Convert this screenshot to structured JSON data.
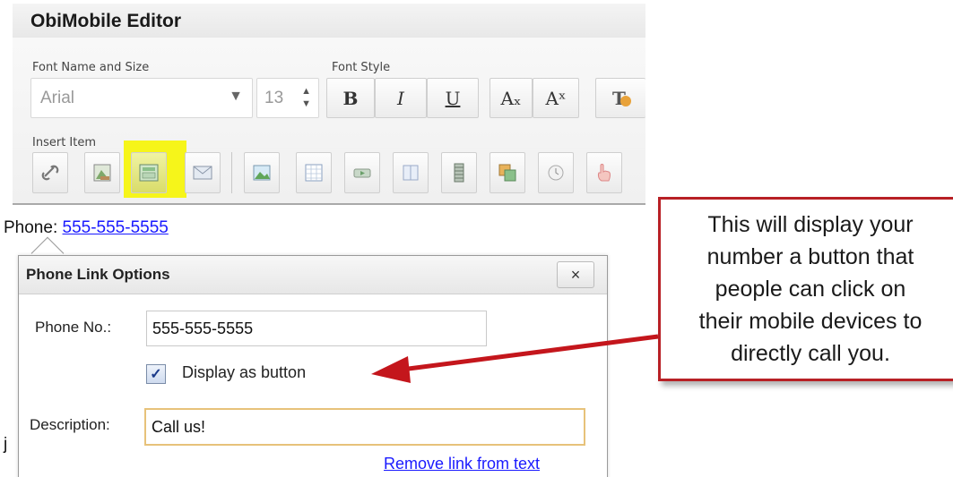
{
  "editor": {
    "title": "ObiMobile Editor",
    "font_group_label": "Font Name and Size",
    "font_name": "Arial",
    "font_size": "13",
    "style_group_label": "Font Style",
    "style_buttons": [
      "B",
      "I",
      "U",
      "Aₓ",
      "Aˣ"
    ],
    "insert_group_label": "Insert Item",
    "insert_icons": [
      "link-icon",
      "image-link-icon",
      "phone-link-icon",
      "email-link-icon",
      "image-icon",
      "table-icon",
      "button-icon",
      "columns-icon",
      "film-icon",
      "gallery-icon",
      "clock-icon",
      "hand-icon"
    ],
    "highlight_color": "#f6f51a"
  },
  "content": {
    "phone_label": "Phone:",
    "phone_link": "555-555-5555",
    "stray_text": "j"
  },
  "dialog": {
    "title": "Phone Link Options",
    "close_label": "×",
    "phone_label": "Phone No.:",
    "phone_value": "555-555-5555",
    "checkbox_checked": true,
    "checkbox_label": "Display as button",
    "description_label": "Description:",
    "description_value": "Call us!",
    "remove_link": "Remove link from text"
  },
  "callout": {
    "lines": [
      "This will display your",
      "number a button that",
      "people can click on",
      "their mobile devices to",
      "directly call you."
    ],
    "border_color": "#b82025"
  }
}
